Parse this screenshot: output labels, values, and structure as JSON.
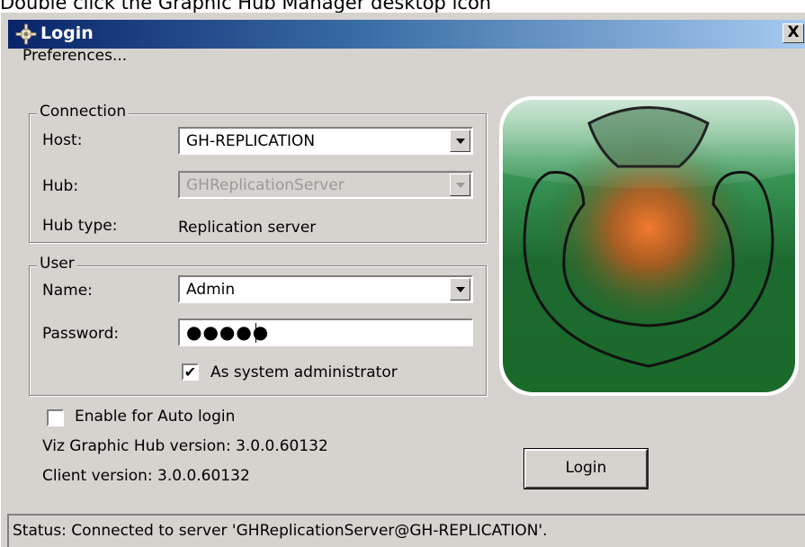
{
  "caption": "Double click the Graphic Hub Manager desktop icon",
  "window": {
    "title": "Login",
    "close_label": "X"
  },
  "menu": {
    "preferences": "Preferences..."
  },
  "connection": {
    "group_label": "Connection",
    "host_label": "Host:",
    "host_value": "GH-REPLICATION",
    "hub_label": "Hub:",
    "hub_value": "GHReplicationServer",
    "hub_type_label": "Hub type:",
    "hub_type_value": "Replication server"
  },
  "user": {
    "group_label": "User",
    "name_label": "Name:",
    "name_value": "Admin",
    "password_label": "Password:",
    "password_value": "●●●●●",
    "sysadmin_label": "As system administrator",
    "sysadmin_checked": true
  },
  "auto_login": {
    "label": "Enable for Auto login",
    "checked": false
  },
  "versions": {
    "hub": "Viz Graphic Hub version: 3.0.0.60132",
    "client": "Client version: 3.0.0.60132"
  },
  "login_button": "Login",
  "status": "Status: Connected to server 'GHReplicationServer@GH-REPLICATION'.",
  "logo_icon": "graphic-hub-logo",
  "colors": {
    "title_dark": "#0a246a",
    "title_light": "#a6caf0",
    "dialog_bg": "#d6d3ce",
    "logo_green": "#1f6a2e",
    "logo_orange": "#f07a30"
  }
}
